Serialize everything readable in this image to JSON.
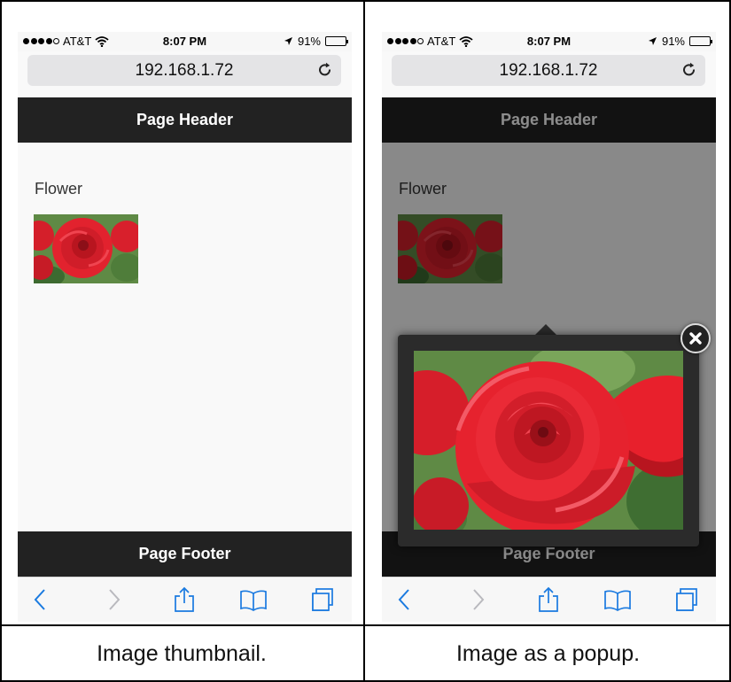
{
  "left_panel": {
    "status": {
      "carrier": "AT&T",
      "time": "8:07 PM",
      "battery": "91%",
      "signal_bars": 4
    },
    "url": "192.168.1.72",
    "header_title": "Page Header",
    "content_label": "Flower",
    "footer_title": "Page Footer",
    "caption": "Image thumbnail."
  },
  "right_panel": {
    "status": {
      "carrier": "AT&T",
      "time": "8:07 PM",
      "battery": "91%",
      "signal_bars": 4
    },
    "url": "192.168.1.72",
    "header_title": "Page Header",
    "content_label": "Flower",
    "footer_title": "Page Footer",
    "caption": "Image as a popup."
  },
  "icons": {
    "signal": "signal-dots-icon",
    "wifi": "wifi-icon",
    "location": "location-arrow-icon",
    "battery": "battery-icon",
    "reload": "reload-icon",
    "back": "back-chevron-icon",
    "forward": "forward-chevron-icon",
    "share": "share-icon",
    "bookmarks": "bookmarks-book-icon",
    "tabs": "tabs-icon",
    "close": "close-x-icon"
  },
  "colors": {
    "bar": "#222222",
    "ios_blue": "#1a7ae0",
    "flower_red": "#e8202c"
  }
}
